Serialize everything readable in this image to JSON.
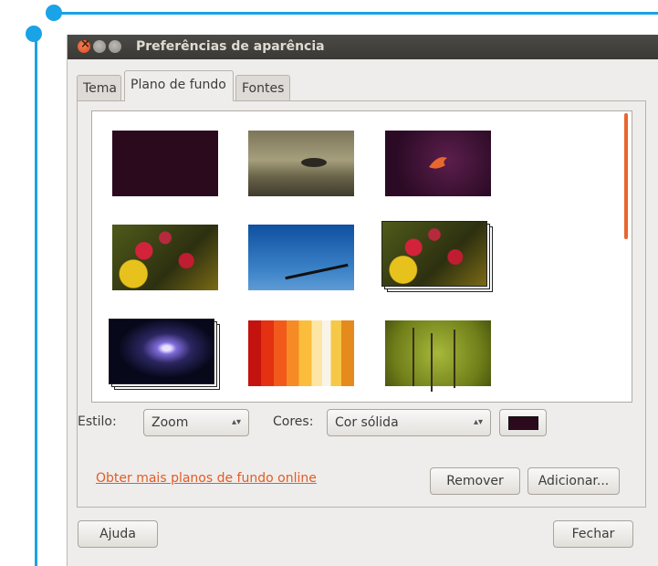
{
  "window": {
    "title": "Preferências de aparência"
  },
  "tabs": [
    {
      "label": "Tema"
    },
    {
      "label": "Plano de fundo",
      "active": true
    },
    {
      "label": "Fontes"
    }
  ],
  "wallpapers": [
    {
      "name": "aubergine",
      "selected": false
    },
    {
      "name": "tree",
      "selected": false
    },
    {
      "name": "bird",
      "selected": false
    },
    {
      "name": "flowers",
      "selected": false
    },
    {
      "name": "blue",
      "selected": false
    },
    {
      "name": "flowers-slideshow",
      "selected": false
    },
    {
      "name": "comet-slideshow",
      "selected": false
    },
    {
      "name": "stripes",
      "selected": false
    },
    {
      "name": "green",
      "selected": false
    }
  ],
  "controls": {
    "style_label": "Estilo:",
    "style_value": "Zoom",
    "colors_label": "Cores:",
    "colors_value": "Cor sólida",
    "swatch_color": "#2c0a1e"
  },
  "links": {
    "more_online": "Obter mais planos de fundo online"
  },
  "buttons": {
    "remove": "Remover",
    "add": "Adicionar...",
    "help": "Ajuda",
    "close": "Fechar"
  },
  "colors": {
    "accent": "#e25b26",
    "titlebar": "#3c3b37",
    "callout": "#1aa3e6"
  }
}
